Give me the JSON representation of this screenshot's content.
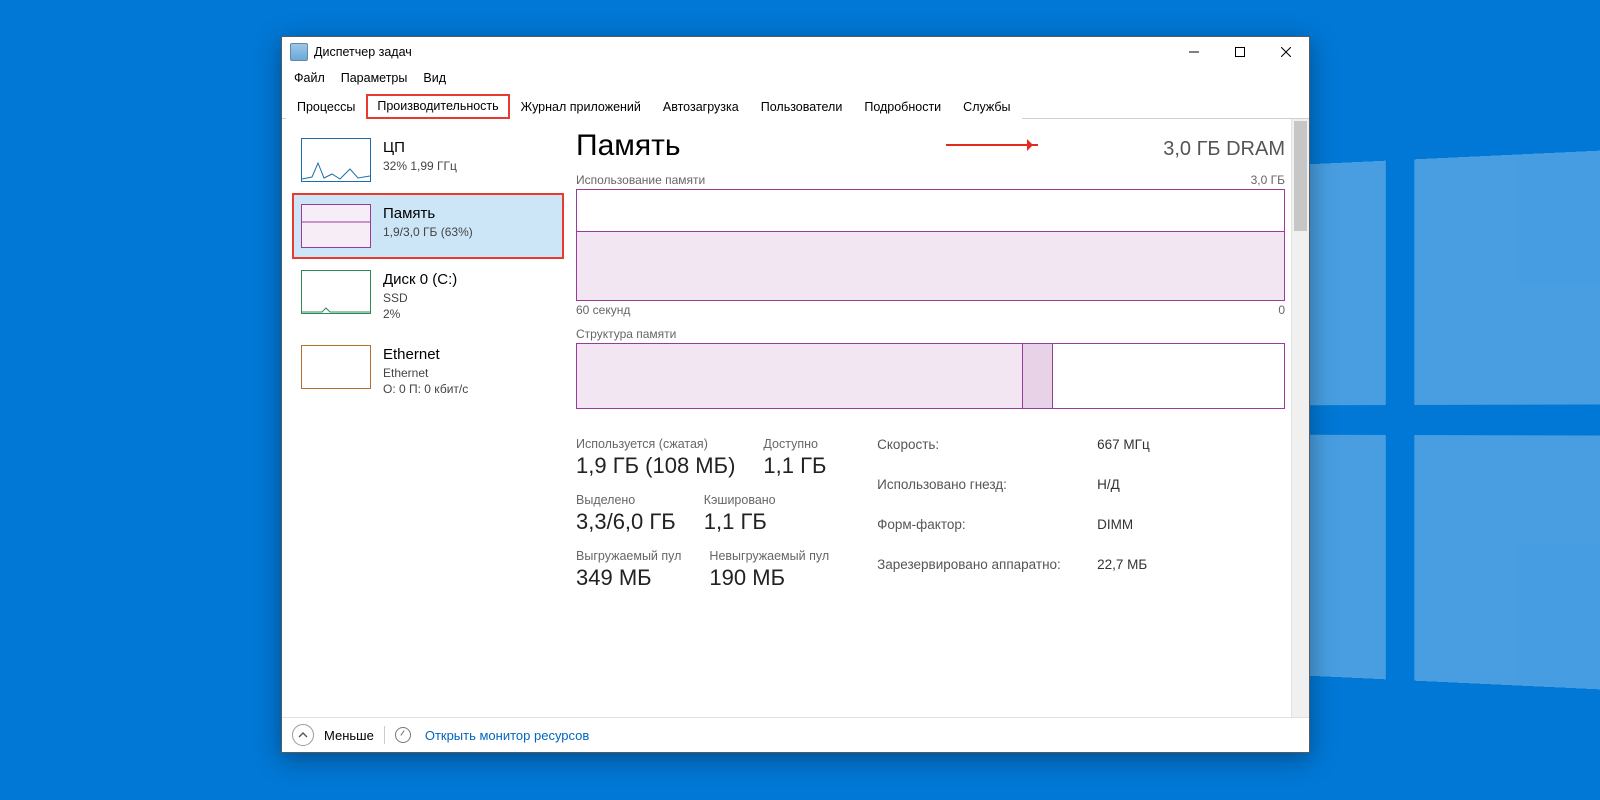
{
  "window": {
    "title": "Диспетчер задач"
  },
  "menu": [
    "Файл",
    "Параметры",
    "Вид"
  ],
  "tabs": [
    "Процессы",
    "Производительность",
    "Журнал приложений",
    "Автозагрузка",
    "Пользователи",
    "Подробности",
    "Службы"
  ],
  "active_tab": 1,
  "sidebar": [
    {
      "title": "ЦП",
      "sub": "32%  1,99 ГГц"
    },
    {
      "title": "Память",
      "sub": "1,9/3,0 ГБ (63%)"
    },
    {
      "title": "Диск 0 (C:)",
      "sub": "SSD",
      "sub2": "2%"
    },
    {
      "title": "Ethernet",
      "sub": "Ethernet",
      "sub2": "О: 0  П: 0 кбит/с"
    }
  ],
  "selected_sidebar": 1,
  "main": {
    "title": "Память",
    "total": "3,0 ГБ DRAM",
    "usage_label": "Использование памяти",
    "usage_max": "3,0 ГБ",
    "axis_left": "60 секунд",
    "axis_right": "0",
    "comp_label": "Структура памяти",
    "cells": [
      {
        "lbl": "Используется (сжатая)",
        "val": "1,9 ГБ (108 МБ)"
      },
      {
        "lbl": "Доступно",
        "val": "1,1 ГБ"
      },
      {
        "lbl": "Выделено",
        "val": "3,3/6,0 ГБ"
      },
      {
        "lbl": "Кэшировано",
        "val": "1,1 ГБ"
      },
      {
        "lbl": "Выгружаемый пул",
        "val": "349 МБ"
      },
      {
        "lbl": "Невыгружаемый пул",
        "val": "190 МБ"
      }
    ],
    "kv": [
      {
        "k": "Скорость:",
        "v": "667 МГц"
      },
      {
        "k": "Использовано гнезд:",
        "v": "Н/Д"
      },
      {
        "k": "Форм-фактор:",
        "v": "DIMM"
      },
      {
        "k": "Зарезервировано аппаратно:",
        "v": "22,7 МБ"
      }
    ]
  },
  "footer": {
    "less": "Меньше",
    "monitor": "Открыть монитор ресурсов"
  },
  "chart_data": {
    "type": "area",
    "title": "Использование памяти",
    "ylabel": "ГБ",
    "ylim": [
      0,
      3.0
    ],
    "x_range_seconds": 60,
    "series": [
      {
        "name": "Память",
        "approx_constant_value": 1.9
      }
    ],
    "composition": {
      "used_pct": 63,
      "modified_pct": 4,
      "free_pct": 33
    }
  }
}
